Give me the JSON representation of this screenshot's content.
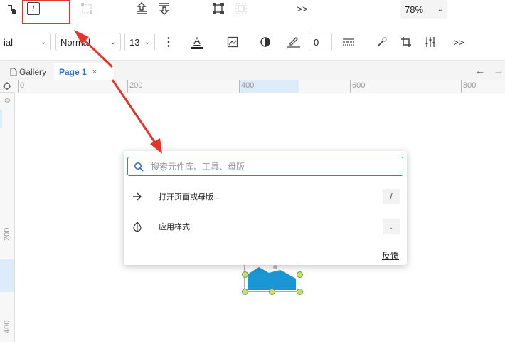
{
  "toolbar_top": {
    "zoom_value": "78%",
    "more_label": ">>"
  },
  "toolbar_format": {
    "font_family_value": "ial",
    "font_weight_value": "Normal",
    "font_size_value": "13",
    "more_label": ">>",
    "stroke_width_value": "0",
    "text_color_icon_label": "A"
  },
  "tabs": {
    "items": [
      {
        "label": "Gallery"
      },
      {
        "label": "Page 1"
      }
    ],
    "close_label": "×"
  },
  "ruler": {
    "h_labels": [
      "0",
      "200",
      "400",
      "600",
      "800"
    ],
    "v_labels": [
      "0",
      "200",
      "400"
    ]
  },
  "quick_palette": {
    "search_placeholder": "搜索元件库、工具、母版",
    "commands": [
      {
        "label": "打开页面或母版...",
        "shortcut": "/",
        "icon": "arrow-right-icon"
      },
      {
        "label": "应用样式",
        "shortcut": ".",
        "icon": "style-drop-icon"
      }
    ],
    "feedback_label": "反馈"
  },
  "shortcut_key_highlight": "/",
  "colors": {
    "accent": "#3b7ddd",
    "annotation_red": "#e5342b",
    "image_fill": "#1b96d4",
    "handle_fill": "#c8e06a"
  }
}
